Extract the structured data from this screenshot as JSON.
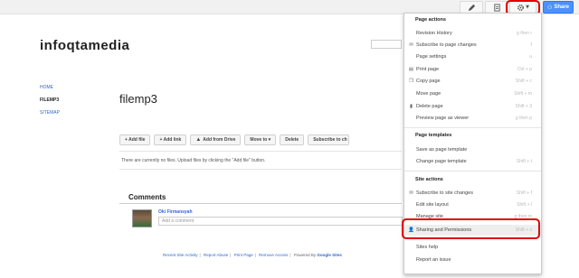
{
  "toolbar": {
    "edit_icon": "pencil-icon",
    "new_page_icon": "new-page-icon",
    "more_icon": "gear-icon",
    "more_caret": "▼",
    "share_label": "Share"
  },
  "site": {
    "title": "infoqtamedia"
  },
  "nav": {
    "items": [
      {
        "label": "HOME",
        "active": false
      },
      {
        "label": "FILEMP3",
        "active": true
      },
      {
        "label": "SITEMAP",
        "active": false
      }
    ]
  },
  "page": {
    "title": "filemp3",
    "buttons": {
      "add_file": "+ Add file",
      "add_link": "+ Add link",
      "add_from_drive": "Add from Drive",
      "move_to": "Move to ▾",
      "delete": "Delete",
      "subscribe": "Subscribe to ch"
    },
    "empty_message": "There are currently no files. Upload files by clicking the \"Add file\" button."
  },
  "comments": {
    "title": "Comments",
    "commenter": "Oki Firmansyah",
    "input_placeholder": "Add a comment"
  },
  "footer": {
    "recent_activity": "Recent Site Activity",
    "report_abuse": "Report Abuse",
    "print_page": "Print Page",
    "remove_access": "Remove Access",
    "powered_by": "Powered By",
    "google_sites": "Google Sites",
    "sep": "|"
  },
  "menu": {
    "page_actions": {
      "header": "Page actions",
      "items": [
        {
          "label": "Revision History",
          "shortcut": "g then r",
          "icon": ""
        },
        {
          "label": "Subscribe to page changes",
          "shortcut": "f",
          "icon": "envelope-icon"
        },
        {
          "label": "Page settings",
          "shortcut": "u",
          "icon": ""
        },
        {
          "label": "Print page",
          "shortcut": "Ctrl + p",
          "icon": "printer-icon"
        },
        {
          "label": "Copy page",
          "shortcut": "Shift + c",
          "icon": "copy-icon"
        },
        {
          "label": "Move page",
          "shortcut": "Shift + m",
          "icon": ""
        },
        {
          "label": "Delete page",
          "shortcut": "Shift + 3",
          "icon": "trash-icon"
        },
        {
          "label": "Preview page as viewer",
          "shortcut": "g then p",
          "icon": ""
        }
      ]
    },
    "page_templates": {
      "header": "Page templates",
      "items": [
        {
          "label": "Save as page template",
          "shortcut": ""
        },
        {
          "label": "Change page template",
          "shortcut": "Shift + t"
        }
      ]
    },
    "site_actions": {
      "header": "Site actions",
      "items": [
        {
          "label": "Subscribe to site changes",
          "shortcut": "Shift + f",
          "icon": "envelope-icon"
        },
        {
          "label": "Edit site layout",
          "shortcut": "Shift + l",
          "icon": ""
        },
        {
          "label": "Manage site",
          "shortcut": "g then m",
          "icon": ""
        },
        {
          "label": "Sharing and Permissions",
          "shortcut": "Shift + s",
          "icon": "add-person-icon"
        },
        {
          "label": "Sites help",
          "shortcut": "",
          "icon": ""
        },
        {
          "label": "Report an issue",
          "shortcut": "",
          "icon": ""
        }
      ]
    }
  },
  "colors": {
    "share_blue": "#4d90fe",
    "highlight_red": "#e00000",
    "link_blue": "#3366cc"
  }
}
